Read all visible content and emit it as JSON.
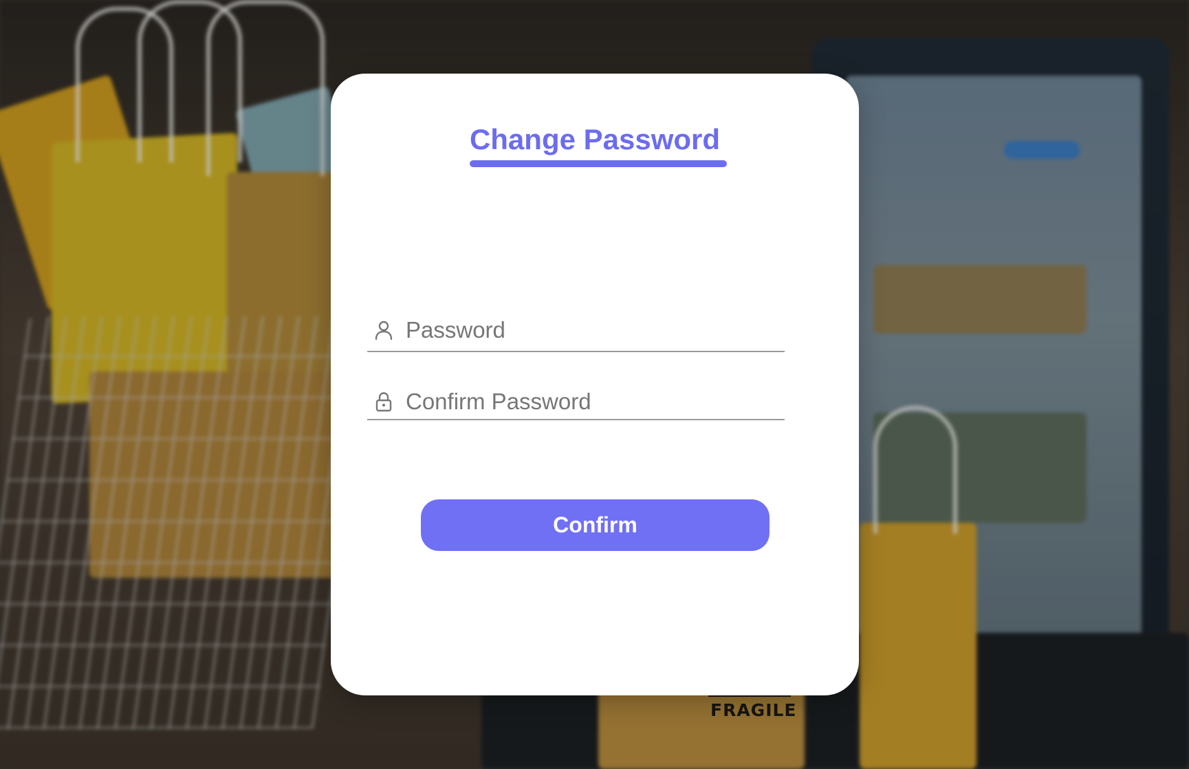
{
  "page": {
    "title": "Change Password",
    "accent_color": "#6c6cf0",
    "button_color": "#7070f5"
  },
  "form": {
    "password": {
      "placeholder": "Password",
      "value": "",
      "icon": "user-icon"
    },
    "confirm_password": {
      "placeholder": "Confirm Password",
      "value": "",
      "icon": "lock-icon"
    },
    "submit_label": "Confirm"
  },
  "background": {
    "box_label": "FRAGILE"
  }
}
